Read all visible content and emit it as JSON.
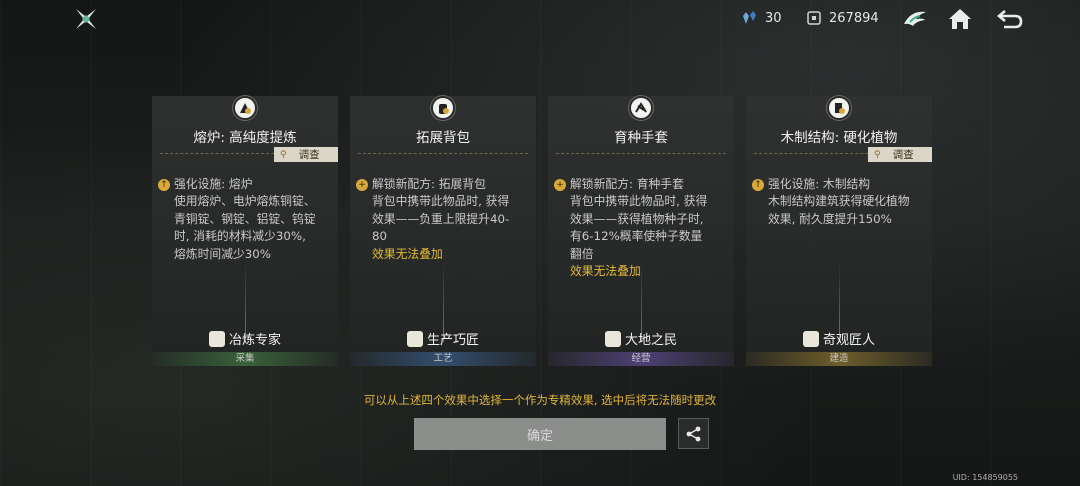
{
  "topbar": {
    "resource_a": "30",
    "resource_b": "267894",
    "icons": [
      "crystal-icon",
      "puzzle-currency-icon",
      "wing-emblem-icon",
      "home-icon",
      "back-arrow-icon"
    ]
  },
  "cards": [
    {
      "title": "熔炉: 高纯度提炼",
      "inspect_label": "调查",
      "desc_head": "强化设施: 熔炉",
      "desc_lines": [
        "使用熔炉、电炉熔炼铜锭、",
        "青铜锭、钢锭、铝锭、钨锭",
        "时, 消耗的材料减少30%,",
        "熔炼时间减少30%"
      ],
      "warn": "",
      "footer_title": "冶炼专家",
      "category": "采集",
      "accent": "#4e8a4e"
    },
    {
      "title": "拓展背包",
      "inspect_label": "",
      "desc_head": "解锁新配方: 拓展背包",
      "desc_lines": [
        "背包中携带此物品时, 获得",
        "效果——负重上限提升40-",
        "80"
      ],
      "warn": "效果无法叠加",
      "footer_title": "生产巧匠",
      "category": "工艺",
      "accent": "#4a6f9e"
    },
    {
      "title": "育种手套",
      "inspect_label": "",
      "desc_head": "解锁新配方: 育种手套",
      "desc_lines": [
        "背包中携带此物品时, 获得",
        "效果——获得植物种子时,",
        "有6-12%概率使种子数量",
        "翻倍"
      ],
      "warn": "效果无法叠加",
      "footer_title": "大地之民",
      "category": "经营",
      "accent": "#6e5aa8"
    },
    {
      "title": "木制结构: 硬化植物",
      "inspect_label": "调查",
      "desc_head": "强化设施: 木制结构",
      "desc_lines": [
        "木制结构建筑获得硬化植物",
        "效果, 耐久度提升150%"
      ],
      "warn": "",
      "footer_title": "奇观匠人",
      "category": "建造",
      "accent": "#9a7f30"
    }
  ],
  "hint": "可以从上述四个效果中选择一个作为专精效果, 选中后将无法随时更改",
  "confirm_label": "确定",
  "uid": "UID: 154859055",
  "colors": {
    "highlight": "#e0b43c",
    "button": "#8c8e8c"
  }
}
